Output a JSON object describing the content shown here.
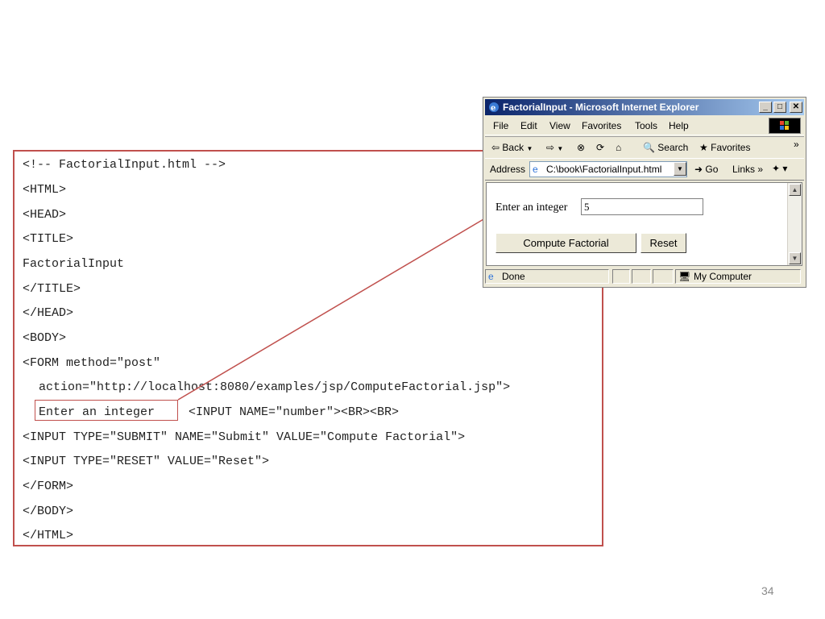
{
  "code": {
    "lines": [
      "<!-- FactorialInput.html -->",
      "<HTML>",
      "<HEAD>",
      "<TITLE>",
      "FactorialInput",
      "</TITLE>",
      "</HEAD>",
      "<BODY>",
      "<FORM method=\"post\"",
      "action=\"http://localhost:8080/examples/jsp/ComputeFactorial.jsp\">",
      "Enter an integer",
      "<INPUT NAME=\"number\"><BR><BR>",
      "<INPUT TYPE=\"SUBMIT\" NAME=\"Submit\" VALUE=\"Compute Factorial\">",
      "<INPUT TYPE=\"RESET\" VALUE=\"Reset\">",
      "</FORM>",
      "</BODY>",
      "</HTML>"
    ]
  },
  "browser": {
    "title": "FactorialInput - Microsoft Internet Explorer",
    "window_buttons": {
      "minimize": "_",
      "maximize": "□",
      "close": "✕"
    },
    "menu": [
      "File",
      "Edit",
      "View",
      "Favorites",
      "Tools",
      "Help"
    ],
    "toolbar": {
      "back": "Back",
      "search": "Search",
      "favorites": "Favorites",
      "overflow": "»"
    },
    "address": {
      "label": "Address",
      "value": "C:\\book\\FactorialInput.html",
      "go": "Go",
      "links": "Links",
      "links_overflow": "»"
    },
    "page": {
      "prompt": "Enter an integer",
      "input_value": "5",
      "submit_label": "Compute Factorial",
      "reset_label": "Reset"
    },
    "status": {
      "left": "Done",
      "zone": "My Computer"
    }
  },
  "slide": {
    "page_number": "34"
  },
  "colors": {
    "accent": "#c0504d",
    "titlebar_start": "#0a246a",
    "titlebar_end": "#a6caf0"
  }
}
